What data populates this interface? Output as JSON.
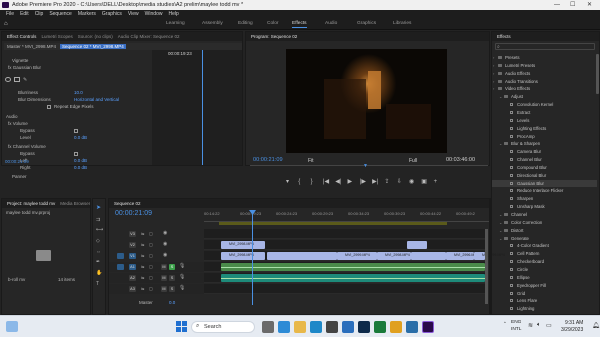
{
  "window": {
    "title": "Adobe Premiere Pro 2020 - C:\\Users\\DELL\\Desktop\\media studies\\A2 prelim\\maylee todd mv *",
    "min": "—",
    "max": "☐",
    "close": "✕"
  },
  "menu": [
    "File",
    "Edit",
    "Clip",
    "Sequence",
    "Markers",
    "Graphics",
    "View",
    "Window",
    "Help"
  ],
  "workspaces": [
    "Learning",
    "Assembly",
    "Editing",
    "Color",
    "Effects",
    "Audio",
    "Graphics",
    "Libraries"
  ],
  "workspace_active": "Effects",
  "effect_controls": {
    "tabs": [
      "Effect Controls",
      "Lumetri Scopes",
      "Source: (no clips)",
      "Audio Clip Mixer: Sequence 02"
    ],
    "source_label": "Master * MVI_2998.MP4",
    "seq_label": "Sequence 02 * MVI_2998.MP4",
    "ruler_time": "00:00:19:23",
    "rows": [
      {
        "label": "Vignette",
        "indent": 8
      },
      {
        "label": "fx  Gaussian Blur",
        "indent": 4
      },
      {
        "label": "Blurriness",
        "indent": 14,
        "value": "10.0"
      },
      {
        "label": "Blur Dimensions",
        "indent": 14,
        "value": "Horizontal and Vertical"
      },
      {
        "label": "Repeat Edge Pixels",
        "indent": 50
      },
      {
        "label": "Audio",
        "indent": 2
      },
      {
        "label": "fx  Volume",
        "indent": 4
      },
      {
        "label": "Bypass",
        "indent": 16
      },
      {
        "label": "Level",
        "indent": 16,
        "value": "0.0 dB"
      },
      {
        "label": "fx  Channel Volume",
        "indent": 4
      },
      {
        "label": "Bypass",
        "indent": 16
      },
      {
        "label": "Left",
        "indent": 16,
        "value": "0.0 dB"
      },
      {
        "label": "Right",
        "indent": 16,
        "value": "0.0 dB"
      },
      {
        "label": "Panner",
        "indent": 8
      }
    ],
    "timecode": "00:00:21:09"
  },
  "program": {
    "title": "Program: Sequence 02",
    "timecode": "00:00:21:09",
    "fit": "Fit",
    "quality": "Full",
    "duration": "00:03:46:00"
  },
  "project": {
    "tabs": [
      "Project: maylee todd mv",
      "Media Browser"
    ],
    "file": "maylee todd mv.prproj",
    "bin_label": "b-roll mv",
    "bin_count": "14 items"
  },
  "timeline": {
    "title": "Sequence 02",
    "timecode": "00:00:21:09",
    "ruler": [
      "00:14:22",
      "00:00:19:23",
      "00:00:24:23",
      "00:00:29:23",
      "00:00:34:23",
      "00:00:39:23",
      "00:00:44:22",
      "00:00:49:2"
    ],
    "tracks": [
      {
        "name": "V3",
        "kind": "video"
      },
      {
        "name": "V2",
        "kind": "video"
      },
      {
        "name": "V1",
        "kind": "video",
        "target": true
      },
      {
        "name": "A1",
        "kind": "audio",
        "target": true
      },
      {
        "name": "A2",
        "kind": "audio"
      },
      {
        "name": "A3",
        "kind": "audio"
      }
    ],
    "master": "Master",
    "master_value": "0.0",
    "clips": [
      "MVI_2998.MP4",
      "MVI_2999.MP4",
      "MVI_2998.MP4",
      "MVI_2996.MP4",
      "MVI_299.MP4"
    ]
  },
  "effects": {
    "title": "Effects",
    "items": [
      {
        "label": "Presets",
        "level": 1,
        "folder": true
      },
      {
        "label": "Lumetri Presets",
        "level": 1,
        "folder": true
      },
      {
        "label": "Audio Effects",
        "level": 1,
        "folder": true
      },
      {
        "label": "Audio Transitions",
        "level": 1,
        "folder": true
      },
      {
        "label": "Video Effects",
        "level": 1,
        "folder": true
      },
      {
        "label": "Adjust",
        "level": 2,
        "folder": true
      },
      {
        "label": "Convolution Kernel",
        "level": 3
      },
      {
        "label": "Extract",
        "level": 3
      },
      {
        "label": "Levels",
        "level": 3
      },
      {
        "label": "Lighting Effects",
        "level": 3
      },
      {
        "label": "ProcAmp",
        "level": 3
      },
      {
        "label": "Blur & Sharpen",
        "level": 2,
        "folder": true
      },
      {
        "label": "Camera Blur",
        "level": 3
      },
      {
        "label": "Channel Blur",
        "level": 3
      },
      {
        "label": "Compound Blur",
        "level": 3
      },
      {
        "label": "Directional Blur",
        "level": 3
      },
      {
        "label": "Gaussian Blur",
        "level": 3,
        "selected": true
      },
      {
        "label": "Reduce Interlace Flicker",
        "level": 3
      },
      {
        "label": "Sharpen",
        "level": 3
      },
      {
        "label": "Unsharp Mask",
        "level": 3
      },
      {
        "label": "Channel",
        "level": 2,
        "folder": true
      },
      {
        "label": "Color Correction",
        "level": 2,
        "folder": true
      },
      {
        "label": "Distort",
        "level": 2,
        "folder": true
      },
      {
        "label": "Generate",
        "level": 2,
        "folder": true
      },
      {
        "label": "4-Color Gradient",
        "level": 3
      },
      {
        "label": "Cell Pattern",
        "level": 3
      },
      {
        "label": "Checkerboard",
        "level": 3
      },
      {
        "label": "Circle",
        "level": 3
      },
      {
        "label": "Ellipse",
        "level": 3
      },
      {
        "label": "Eyedropper Fill",
        "level": 3
      },
      {
        "label": "Grid",
        "level": 3
      },
      {
        "label": "Lens Flare",
        "level": 3
      },
      {
        "label": "Lightning",
        "level": 3
      }
    ]
  },
  "taskbar": {
    "search": "Search",
    "lang_top": "ENG",
    "lang_bottom": "INTL",
    "time": "9:31 AM",
    "date": "3/29/2023"
  },
  "colors": {
    "accent": "#4a90e2",
    "video_clip": "#a8b6e6",
    "audio_clip": "#4a8b4a",
    "playhead": "#4a90e2"
  }
}
